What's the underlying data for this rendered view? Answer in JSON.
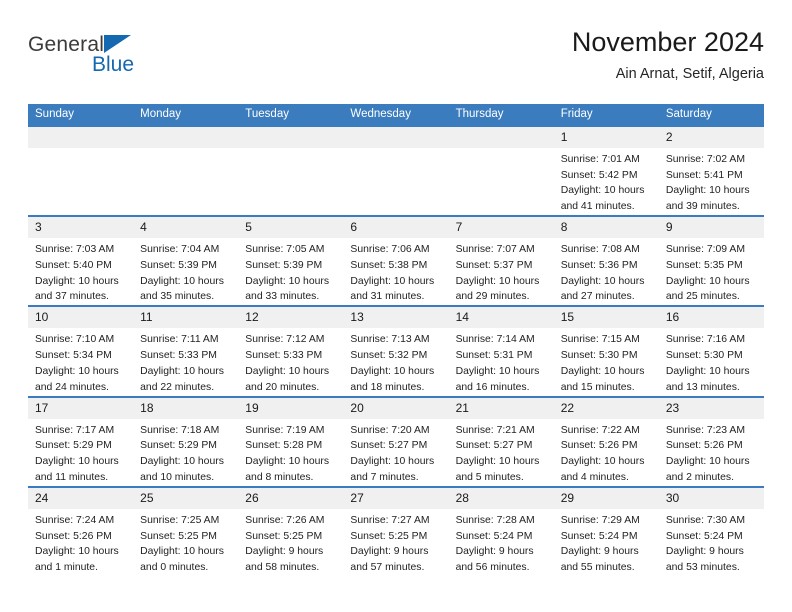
{
  "brand": {
    "name_top": "General",
    "name_bottom": "Blue",
    "triangle_color": "#1569b0"
  },
  "header": {
    "title": "November 2024",
    "subtitle": "Ain Arnat, Setif, Algeria"
  },
  "theme": {
    "header_blue": "#3a7cbe",
    "daynum_band": "#f0f0f0",
    "text": "#1f1f1f"
  },
  "calendar": {
    "weekday_headers": [
      "Sunday",
      "Monday",
      "Tuesday",
      "Wednesday",
      "Thursday",
      "Friday",
      "Saturday"
    ],
    "weeks": [
      [
        {
          "day": "",
          "lines": []
        },
        {
          "day": "",
          "lines": []
        },
        {
          "day": "",
          "lines": []
        },
        {
          "day": "",
          "lines": []
        },
        {
          "day": "",
          "lines": []
        },
        {
          "day": "1",
          "lines": [
            "Sunrise: 7:01 AM",
            "Sunset: 5:42 PM",
            "Daylight: 10 hours",
            "and 41 minutes."
          ]
        },
        {
          "day": "2",
          "lines": [
            "Sunrise: 7:02 AM",
            "Sunset: 5:41 PM",
            "Daylight: 10 hours",
            "and 39 minutes."
          ]
        }
      ],
      [
        {
          "day": "3",
          "lines": [
            "Sunrise: 7:03 AM",
            "Sunset: 5:40 PM",
            "Daylight: 10 hours",
            "and 37 minutes."
          ]
        },
        {
          "day": "4",
          "lines": [
            "Sunrise: 7:04 AM",
            "Sunset: 5:39 PM",
            "Daylight: 10 hours",
            "and 35 minutes."
          ]
        },
        {
          "day": "5",
          "lines": [
            "Sunrise: 7:05 AM",
            "Sunset: 5:39 PM",
            "Daylight: 10 hours",
            "and 33 minutes."
          ]
        },
        {
          "day": "6",
          "lines": [
            "Sunrise: 7:06 AM",
            "Sunset: 5:38 PM",
            "Daylight: 10 hours",
            "and 31 minutes."
          ]
        },
        {
          "day": "7",
          "lines": [
            "Sunrise: 7:07 AM",
            "Sunset: 5:37 PM",
            "Daylight: 10 hours",
            "and 29 minutes."
          ]
        },
        {
          "day": "8",
          "lines": [
            "Sunrise: 7:08 AM",
            "Sunset: 5:36 PM",
            "Daylight: 10 hours",
            "and 27 minutes."
          ]
        },
        {
          "day": "9",
          "lines": [
            "Sunrise: 7:09 AM",
            "Sunset: 5:35 PM",
            "Daylight: 10 hours",
            "and 25 minutes."
          ]
        }
      ],
      [
        {
          "day": "10",
          "lines": [
            "Sunrise: 7:10 AM",
            "Sunset: 5:34 PM",
            "Daylight: 10 hours",
            "and 24 minutes."
          ]
        },
        {
          "day": "11",
          "lines": [
            "Sunrise: 7:11 AM",
            "Sunset: 5:33 PM",
            "Daylight: 10 hours",
            "and 22 minutes."
          ]
        },
        {
          "day": "12",
          "lines": [
            "Sunrise: 7:12 AM",
            "Sunset: 5:33 PM",
            "Daylight: 10 hours",
            "and 20 minutes."
          ]
        },
        {
          "day": "13",
          "lines": [
            "Sunrise: 7:13 AM",
            "Sunset: 5:32 PM",
            "Daylight: 10 hours",
            "and 18 minutes."
          ]
        },
        {
          "day": "14",
          "lines": [
            "Sunrise: 7:14 AM",
            "Sunset: 5:31 PM",
            "Daylight: 10 hours",
            "and 16 minutes."
          ]
        },
        {
          "day": "15",
          "lines": [
            "Sunrise: 7:15 AM",
            "Sunset: 5:30 PM",
            "Daylight: 10 hours",
            "and 15 minutes."
          ]
        },
        {
          "day": "16",
          "lines": [
            "Sunrise: 7:16 AM",
            "Sunset: 5:30 PM",
            "Daylight: 10 hours",
            "and 13 minutes."
          ]
        }
      ],
      [
        {
          "day": "17",
          "lines": [
            "Sunrise: 7:17 AM",
            "Sunset: 5:29 PM",
            "Daylight: 10 hours",
            "and 11 minutes."
          ]
        },
        {
          "day": "18",
          "lines": [
            "Sunrise: 7:18 AM",
            "Sunset: 5:29 PM",
            "Daylight: 10 hours",
            "and 10 minutes."
          ]
        },
        {
          "day": "19",
          "lines": [
            "Sunrise: 7:19 AM",
            "Sunset: 5:28 PM",
            "Daylight: 10 hours",
            "and 8 minutes."
          ]
        },
        {
          "day": "20",
          "lines": [
            "Sunrise: 7:20 AM",
            "Sunset: 5:27 PM",
            "Daylight: 10 hours",
            "and 7 minutes."
          ]
        },
        {
          "day": "21",
          "lines": [
            "Sunrise: 7:21 AM",
            "Sunset: 5:27 PM",
            "Daylight: 10 hours",
            "and 5 minutes."
          ]
        },
        {
          "day": "22",
          "lines": [
            "Sunrise: 7:22 AM",
            "Sunset: 5:26 PM",
            "Daylight: 10 hours",
            "and 4 minutes."
          ]
        },
        {
          "day": "23",
          "lines": [
            "Sunrise: 7:23 AM",
            "Sunset: 5:26 PM",
            "Daylight: 10 hours",
            "and 2 minutes."
          ]
        }
      ],
      [
        {
          "day": "24",
          "lines": [
            "Sunrise: 7:24 AM",
            "Sunset: 5:26 PM",
            "Daylight: 10 hours",
            "and 1 minute."
          ]
        },
        {
          "day": "25",
          "lines": [
            "Sunrise: 7:25 AM",
            "Sunset: 5:25 PM",
            "Daylight: 10 hours",
            "and 0 minutes."
          ]
        },
        {
          "day": "26",
          "lines": [
            "Sunrise: 7:26 AM",
            "Sunset: 5:25 PM",
            "Daylight: 9 hours",
            "and 58 minutes."
          ]
        },
        {
          "day": "27",
          "lines": [
            "Sunrise: 7:27 AM",
            "Sunset: 5:25 PM",
            "Daylight: 9 hours",
            "and 57 minutes."
          ]
        },
        {
          "day": "28",
          "lines": [
            "Sunrise: 7:28 AM",
            "Sunset: 5:24 PM",
            "Daylight: 9 hours",
            "and 56 minutes."
          ]
        },
        {
          "day": "29",
          "lines": [
            "Sunrise: 7:29 AM",
            "Sunset: 5:24 PM",
            "Daylight: 9 hours",
            "and 55 minutes."
          ]
        },
        {
          "day": "30",
          "lines": [
            "Sunrise: 7:30 AM",
            "Sunset: 5:24 PM",
            "Daylight: 9 hours",
            "and 53 minutes."
          ]
        }
      ]
    ]
  }
}
